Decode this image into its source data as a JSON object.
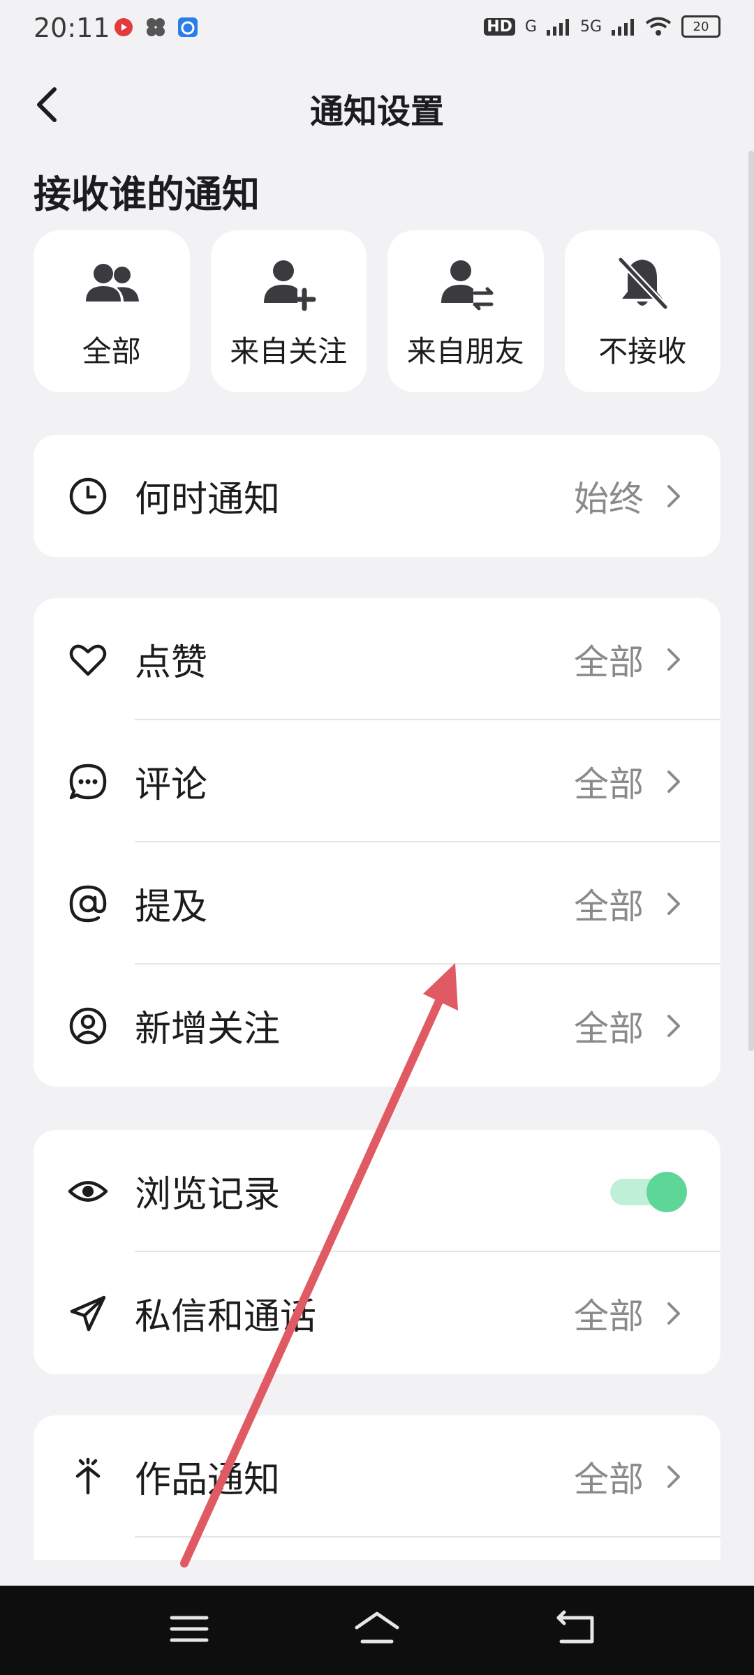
{
  "status": {
    "time": "20:11",
    "network1": "HD",
    "network2": "G",
    "network3": "5G",
    "battery": "20"
  },
  "header": {
    "title": "通知设置"
  },
  "recipients": {
    "heading": "接收谁的通知",
    "options": [
      {
        "label": "全部",
        "icon": "people-icon"
      },
      {
        "label": "来自关注",
        "icon": "person-add-icon"
      },
      {
        "label": "来自朋友",
        "icon": "person-exchange-icon"
      },
      {
        "label": "不接收",
        "icon": "bell-off-icon"
      }
    ]
  },
  "when": {
    "label": "何时通知",
    "value": "始终",
    "icon": "clock-icon"
  },
  "interactions": [
    {
      "label": "点赞",
      "value": "全部",
      "icon": "heart-icon"
    },
    {
      "label": "评论",
      "value": "全部",
      "icon": "comment-icon"
    },
    {
      "label": "提及",
      "value": "全部",
      "icon": "at-icon"
    },
    {
      "label": "新增关注",
      "value": "全部",
      "icon": "user-circle-icon"
    }
  ],
  "browsing": {
    "label": "浏览记录",
    "icon": "eye-icon",
    "enabled": true
  },
  "messages": {
    "label": "私信和通话",
    "value": "全部",
    "icon": "send-icon"
  },
  "works": {
    "label": "作品通知",
    "value": "全部",
    "icon": "sparkle-icon"
  },
  "colors": {
    "toggle_on": "#5ed698",
    "annotation_arrow": "#e05a63"
  }
}
